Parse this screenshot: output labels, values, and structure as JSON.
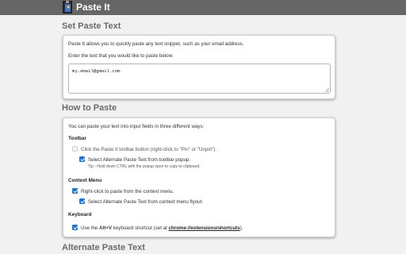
{
  "header": {
    "title": "Paste It"
  },
  "set_paste_text": {
    "heading": "Set Paste Text",
    "intro": "Paste It allows you to quickly paste any text snippet, such as your email address.",
    "prompt": "Enter the text that you would like to paste below:",
    "textarea_value": "my.email@gmail.com"
  },
  "how_to_paste": {
    "heading": "How to Paste",
    "intro": "You can paste your text into input fields in three different ways:",
    "toolbar": {
      "label": "Toolbar",
      "option1": "Click the Paste It toolbar button (right-click to \"Pin\" or \"Unpin\").",
      "option1_checked": false,
      "option2": "Select Alternate Paste Text from toolbar popup.",
      "option2_checked": true,
      "tip": "Tip - Hold down CTRL with the popup open to copy to clipboard."
    },
    "context_menu": {
      "label": "Context Menu",
      "option1": "Right-click to paste from the context menu.",
      "option1_checked": true,
      "option2": "Select Alternate Paste Text from context menu flyout.",
      "option2_checked": true
    },
    "keyboard": {
      "label": "Keyboard",
      "option_prefix": "Use the ",
      "option_shortcut": "Alt+V",
      "option_middle": " keyboard shortcut (set at ",
      "option_link": "chrome://extensions/shortcuts",
      "option_suffix": ").",
      "option_checked": true
    }
  },
  "alternate_paste_text": {
    "heading": "Alternate Paste Text"
  },
  "colors": {
    "header_bg": "#666666",
    "accent": "#1a73e8",
    "page_bg": "#f1f1f1"
  }
}
